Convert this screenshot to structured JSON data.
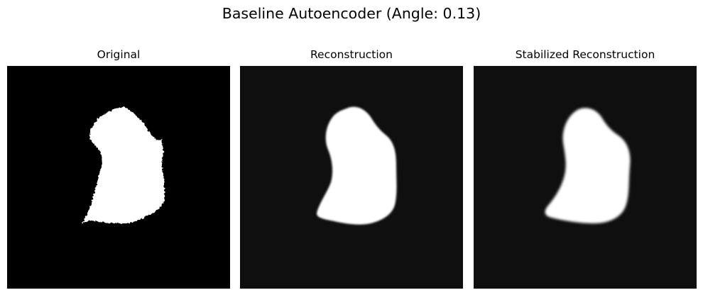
{
  "figure": {
    "title": "Baseline Autoencoder (Angle: 0.13)"
  },
  "panels": [
    {
      "title": "Original",
      "background": "#000000",
      "shape_color": "#ffffff",
      "edge": "jagged"
    },
    {
      "title": "Reconstruction",
      "background": "#0f0f0f",
      "shape_color": "#ffffff",
      "edge": "smooth"
    },
    {
      "title": "Stabilized Reconstruction",
      "background": "#0f0f0f",
      "shape_color": "#ffffff",
      "edge": "smooth"
    }
  ]
}
